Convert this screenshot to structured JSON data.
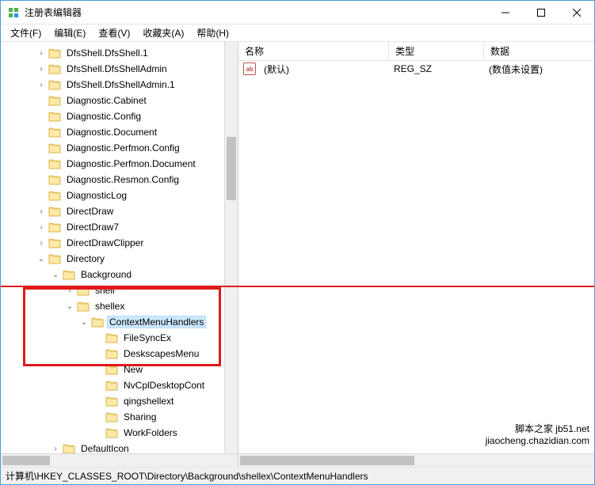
{
  "window": {
    "title": "注册表编辑器"
  },
  "menu": {
    "file": "文件(F)",
    "edit": "编辑(E)",
    "view": "查看(V)",
    "favorites": "收藏夹(A)",
    "help": "帮助(H)"
  },
  "columns": {
    "name": "名称",
    "type": "类型",
    "data": "数据"
  },
  "values": [
    {
      "icon": "ab",
      "name": "(默认)",
      "type": "REG_SZ",
      "data": "(数值未设置)"
    }
  ],
  "tree": [
    {
      "indent": 2,
      "toggle": ">",
      "label": "DfsShell.DfsShell.1"
    },
    {
      "indent": 2,
      "toggle": ">",
      "label": "DfsShell.DfsShellAdmin"
    },
    {
      "indent": 2,
      "toggle": ">",
      "label": "DfsShell.DfsShellAdmin.1"
    },
    {
      "indent": 2,
      "toggle": "",
      "label": "Diagnostic.Cabinet"
    },
    {
      "indent": 2,
      "toggle": "",
      "label": "Diagnostic.Config"
    },
    {
      "indent": 2,
      "toggle": "",
      "label": "Diagnostic.Document"
    },
    {
      "indent": 2,
      "toggle": "",
      "label": "Diagnostic.Perfmon.Config"
    },
    {
      "indent": 2,
      "toggle": "",
      "label": "Diagnostic.Perfmon.Document"
    },
    {
      "indent": 2,
      "toggle": "",
      "label": "Diagnostic.Resmon.Config"
    },
    {
      "indent": 2,
      "toggle": "",
      "label": "DiagnosticLog"
    },
    {
      "indent": 2,
      "toggle": ">",
      "label": "DirectDraw"
    },
    {
      "indent": 2,
      "toggle": ">",
      "label": "DirectDraw7"
    },
    {
      "indent": 2,
      "toggle": ">",
      "label": "DirectDrawClipper"
    },
    {
      "indent": 2,
      "toggle": "v",
      "label": "Directory"
    },
    {
      "indent": 3,
      "toggle": "v",
      "label": "Background"
    },
    {
      "indent": 4,
      "toggle": ">",
      "label": "shell"
    },
    {
      "indent": 4,
      "toggle": "v",
      "label": "shellex"
    },
    {
      "indent": 5,
      "toggle": "v",
      "label": "ContextMenuHandlers",
      "selected": true
    },
    {
      "indent": 6,
      "toggle": "",
      "label": "FileSyncEx"
    },
    {
      "indent": 6,
      "toggle": "",
      "label": "DeskscapesMenu"
    },
    {
      "indent": 6,
      "toggle": "",
      "label": "New"
    },
    {
      "indent": 6,
      "toggle": "",
      "label": "NvCplDesktopCont"
    },
    {
      "indent": 6,
      "toggle": "",
      "label": "qingshellext"
    },
    {
      "indent": 6,
      "toggle": "",
      "label": "Sharing"
    },
    {
      "indent": 6,
      "toggle": "",
      "label": "WorkFolders"
    },
    {
      "indent": 3,
      "toggle": ">",
      "label": "DefaultIcon"
    }
  ],
  "status": {
    "path": "计算机\\HKEY_CLASSES_ROOT\\Directory\\Background\\shellex\\ContextMenuHandlers"
  },
  "watermark": {
    "l1": "脚本之家 jb51.net",
    "l2": "jiaocheng.chazidian.com"
  }
}
